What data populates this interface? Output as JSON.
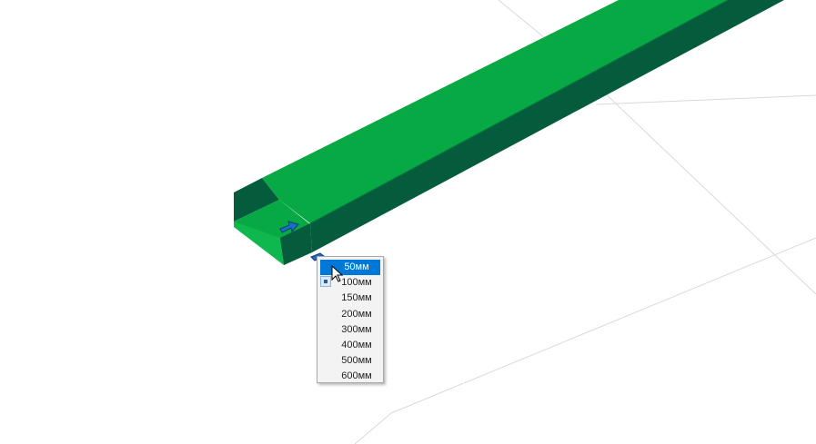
{
  "colors": {
    "background": "#ffffff",
    "grid": "#d9d9d9",
    "tray_top": "#06a944",
    "tray_side": "#055c3c",
    "selection": "#0078d7",
    "handle": "#1a6fc2"
  },
  "icons": {
    "handle_arrow": "arrow-right-icon",
    "handle_grip": "grip-icon",
    "cursor": "mouse-pointer-icon"
  },
  "width_menu": {
    "options": [
      "50мм",
      "100мм",
      "150мм",
      "200мм",
      "300мм",
      "400мм",
      "500мм",
      "600мм"
    ],
    "selected": "50мм"
  }
}
